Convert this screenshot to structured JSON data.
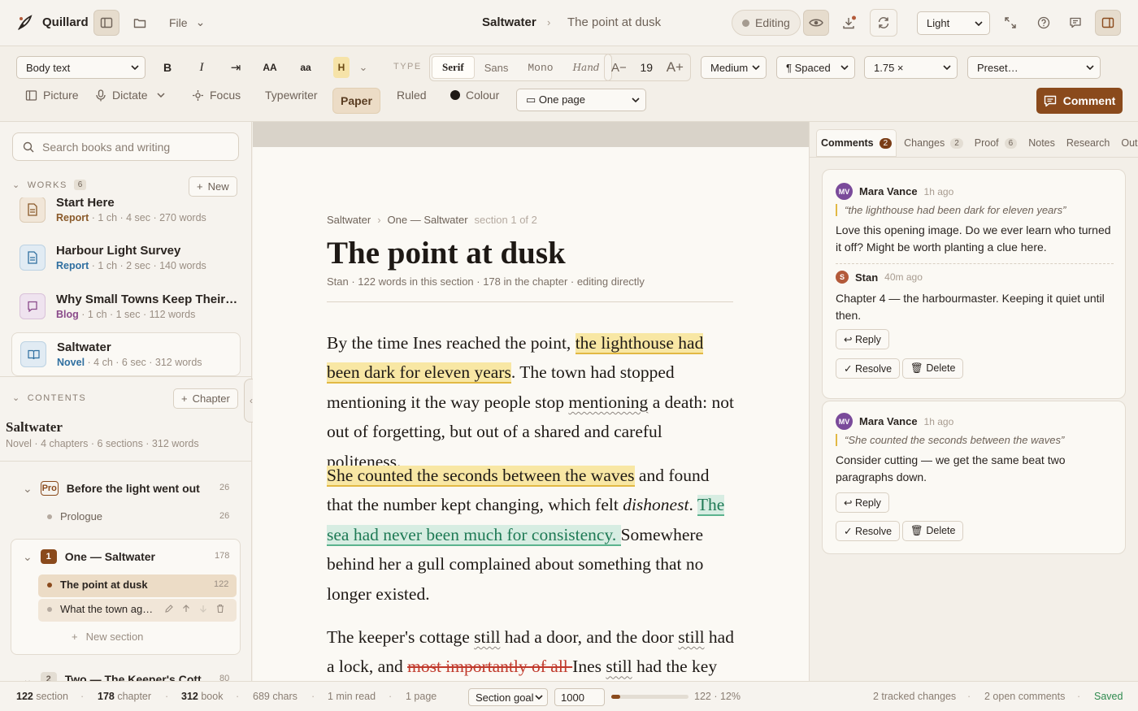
{
  "app": {
    "name": "Quillard"
  },
  "titlebar": {
    "file_menu": "File",
    "doc_title": "Saltwater",
    "doc_sub": "The point at dusk",
    "status": "Editing",
    "theme": "Light"
  },
  "toolbar": {
    "style_select": "Body text",
    "bold": "B",
    "italic": "I",
    "indent": "⇥",
    "uppercase": "AA",
    "lowercase": "aa",
    "highlight": "H",
    "type_label": "TYPE",
    "typefaces": [
      "Serif",
      "Sans",
      "Mono",
      "Hand"
    ],
    "active_typeface": "Serif",
    "size_decrease": "A−",
    "size_value": "19",
    "size_increase": "A+",
    "weight": "Medium",
    "spacing": "¶ Spaced",
    "line_height": "1.75 ×",
    "preset": "Preset…",
    "picture": "Picture",
    "dictate": "Dictate",
    "focus": "Focus",
    "typewriter": "Typewriter",
    "paper": "Paper",
    "ruled": "Ruled",
    "colour": "Colour",
    "page_mode": "▭ One page",
    "comment_button": "Comment"
  },
  "sidebar": {
    "search_placeholder": "Search books and writing",
    "works_label": "WORKS",
    "works_count": "6",
    "new_button": "New",
    "works": [
      {
        "title": "Start Here",
        "type": "Report",
        "meta": " · 1 ch · 4 sec · 270 words",
        "color": "#8a5a2a"
      },
      {
        "title": "Harbour Light Survey",
        "type": "Report",
        "meta": " · 1 ch · 2 sec · 140 words",
        "color": "#2f6fa0"
      },
      {
        "title": "Why Small Towns Keep Their…",
        "type": "Blog",
        "meta": " · 1 ch · 1 sec · 112 words",
        "color": "#8a4a8a"
      },
      {
        "title": "Saltwater",
        "type": "Novel",
        "meta": " · 4 ch · 6 sec · 312 words",
        "color": "#2f6fa0"
      }
    ],
    "contents_label": "CONTENTS",
    "chapter_button": "Chapter",
    "book_title": "Saltwater",
    "book_meta": "Novel · 4 chapters · 6 sections · 312 words",
    "chapters": [
      {
        "badge": "Pro",
        "title": "Before the light went out",
        "count": "26",
        "sections": [
          {
            "title": "Prologue",
            "count": "26"
          }
        ]
      },
      {
        "badge": "1",
        "title": "One — Saltwater",
        "count": "178",
        "sections": [
          {
            "title": "The point at dusk",
            "count": "122"
          },
          {
            "title": "What the town ag…",
            "count": ""
          }
        ],
        "new_section": "New section"
      },
      {
        "badge": "2",
        "title": "Two — The Keeper's Cott",
        "count": "80"
      }
    ]
  },
  "document": {
    "breadcrumb": [
      "Saltwater",
      "›",
      "One — Saltwater",
      "section 1 of 2"
    ],
    "title": "The point at dusk",
    "meta": "Stan · 122 words in this section · 178 in the chapter · editing directly",
    "p1": {
      "a": "By the time Ines reached the point, ",
      "hl": "the lighthouse had been dark for eleven years",
      "b": ". The town had stopped mentioning it the way people stop ",
      "spell": "mentioning",
      "c": " a death: not out of forgetting, but out of a shared and careful politeness."
    },
    "p2": {
      "hl": "She counted the seconds between the waves",
      "a": " and found that the number kept changing, which felt ",
      "em": "dishonest",
      "b": ". ",
      "ins": "The sea had never been much for consistency. ",
      "c": "Somewhere behind her a gull complained about something that no longer existed."
    },
    "p3": {
      "a": "The keeper's cottage ",
      "spell1": "still",
      "b": " had a door, and the door ",
      "spell2": "still",
      "c": " had a lock, and ",
      "del": "most importantly of all ",
      "d": "Ines ",
      "spell3": "still",
      "e": " had the key"
    }
  },
  "rightpanel": {
    "tabs": [
      {
        "label": "Comments",
        "badge": "2"
      },
      {
        "label": "Changes",
        "badge": "2"
      },
      {
        "label": "Proof",
        "badge": "6"
      },
      {
        "label": "Notes",
        "badge": ""
      },
      {
        "label": "Research",
        "badge": ""
      },
      {
        "label": "Outline",
        "badge": ""
      }
    ],
    "comments": [
      {
        "initials": "MV",
        "author": "Mara Vance",
        "time": "1h ago",
        "avatar_color": "#7a4a9a",
        "quote": "“the lighthouse had been dark for eleven years”",
        "body": "Love this opening image. Do we ever learn who turned it off? Might be worth planting a clue here.",
        "reply": {
          "initials": "S",
          "author": "Stan",
          "time": "40m ago",
          "avatar_color": "#b35a3a",
          "body": "Chapter 4 — the harbourmaster. Keeping it quiet until then."
        }
      },
      {
        "initials": "MV",
        "author": "Mara Vance",
        "time": "1h ago",
        "avatar_color": "#7a4a9a",
        "quote": "“She counted the seconds between the waves”",
        "body": "Consider cutting — we get the same beat two paragraphs down."
      }
    ],
    "reply_label": "↩ Reply",
    "resolve_label": "✓ Resolve",
    "delete_label": "🗑 Delete"
  },
  "statusbar": {
    "section_words": "122",
    "section_label": " section",
    "chapter_words": "178",
    "chapter_label": " chapter",
    "book_words": "312",
    "book_label": " book",
    "chars": "689 chars",
    "read": "1 min read",
    "pages": "1 page",
    "goal_select": "Section goal",
    "goal_value": "1000",
    "goal_progress": 0.12,
    "goal_text": "122 · 12%",
    "changes": "2 tracked changes",
    "open_comments": "2 open comments",
    "saved": "Saved"
  }
}
